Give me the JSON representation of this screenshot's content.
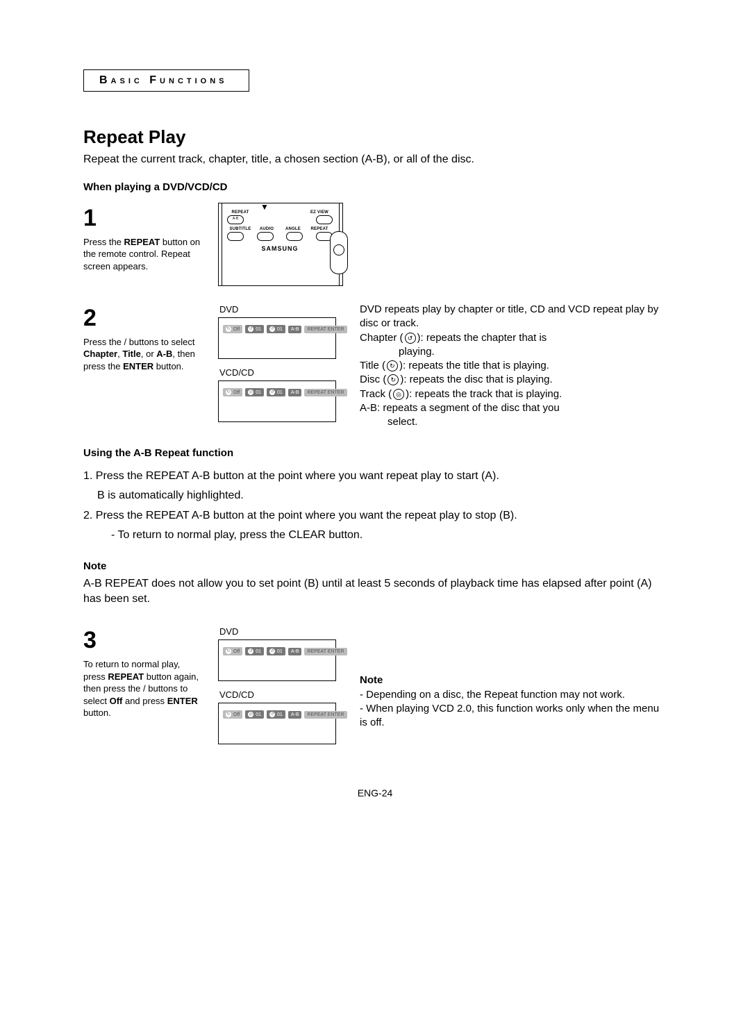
{
  "section": "Basic Functions",
  "title": "Repeat Play",
  "intro": "Repeat the current track, chapter, title, a chosen section (A-B), or all of the disc.",
  "sub1": "When playing a DVD/VCD/CD",
  "step1": {
    "num": "1",
    "line1a": "Press the ",
    "line1b": "REPEAT",
    "line1c": " button on the remote control. Repeat screen appears.",
    "remote": {
      "row1": [
        "REPEAT",
        "",
        "",
        "EZ VIEW"
      ],
      "row1sub": "A-B",
      "row2": [
        "SUBTITLE",
        "AUDIO",
        "ANGLE",
        "REPEAT"
      ],
      "brand": "SAMSUNG"
    }
  },
  "step2": {
    "num": "2",
    "line1a": "Press the ",
    "line1b": " / ",
    "line1c": " buttons to select ",
    "opt1": "Chapter",
    "sep": ", ",
    "opt2": "Title",
    "sep2": ", or ",
    "opt3": "A-B",
    "line2a": ", then press the ",
    "enter": "ENTER",
    "line2b": " button.",
    "osd_dvd_label": "DVD",
    "osd_vcdcd_label": "VCD/CD",
    "osd_dvd": [
      "Off",
      "01",
      "01",
      "A-B",
      "REPEAT  ENTER"
    ],
    "osd_vcd": [
      "Off",
      "01",
      "01",
      "A-B",
      "REPEAT  ENTER"
    ],
    "info": {
      "l1": "DVD repeats play by chapter or title, CD and VCD repeat play by disc or track.",
      "chapter": "Chapter (",
      "chapter_tail": "): repeats the chapter that is",
      "chapter_tail2": "playing.",
      "title": "Title (",
      "title_tail": "): repeats the title that is playing.",
      "disc": "Disc (",
      "disc_tail": "): repeats the disc that is playing.",
      "track": "Track (",
      "track_tail": "): repeats the track that is playing.",
      "ab": "A-B: repeats a segment of the disc that you",
      "ab2": "select."
    }
  },
  "abhead": "Using the A-B Repeat function",
  "ab1": "1.  Press the REPEAT A-B button at the point where you want repeat play to start (A).",
  "ab1b": "B is automatically highlighted.",
  "ab2": "2.  Press the REPEAT A-B button at the point where you want the repeat play to stop (B).",
  "ab2b": "-  To return to normal play, press the CLEAR button.",
  "notehead": "Note",
  "notetext": "A-B REPEAT does not allow you to set point (B) until at least 5 seconds of playback time has elapsed after point (A) has been set.",
  "step3": {
    "num": "3",
    "l1": "To return to normal play, press ",
    "l1b": "REPEAT",
    "l1c": " button again, then press the ",
    "l1d": " / ",
    "l1e": " buttons to select ",
    "off": "Off",
    "l1f": " and press ",
    "enter": "ENTER",
    "l1g": " button.",
    "osd_dvd_label": "DVD",
    "osd_vcdcd_label": "VCD/CD",
    "osd_dvd": [
      "Off",
      "01",
      "01",
      "A-B",
      "REPEAT  ENTER"
    ],
    "osd_vcd": [
      "Off",
      "01",
      "01",
      "A-B",
      "REPEAT  ENTER"
    ],
    "sidenote_head": "Note",
    "sidenote1": "-  Depending on a disc, the Repeat function may not work.",
    "sidenote2": "-  When playing VCD 2.0, this function works only when the menu is off."
  },
  "pagefoot": "ENG-24"
}
